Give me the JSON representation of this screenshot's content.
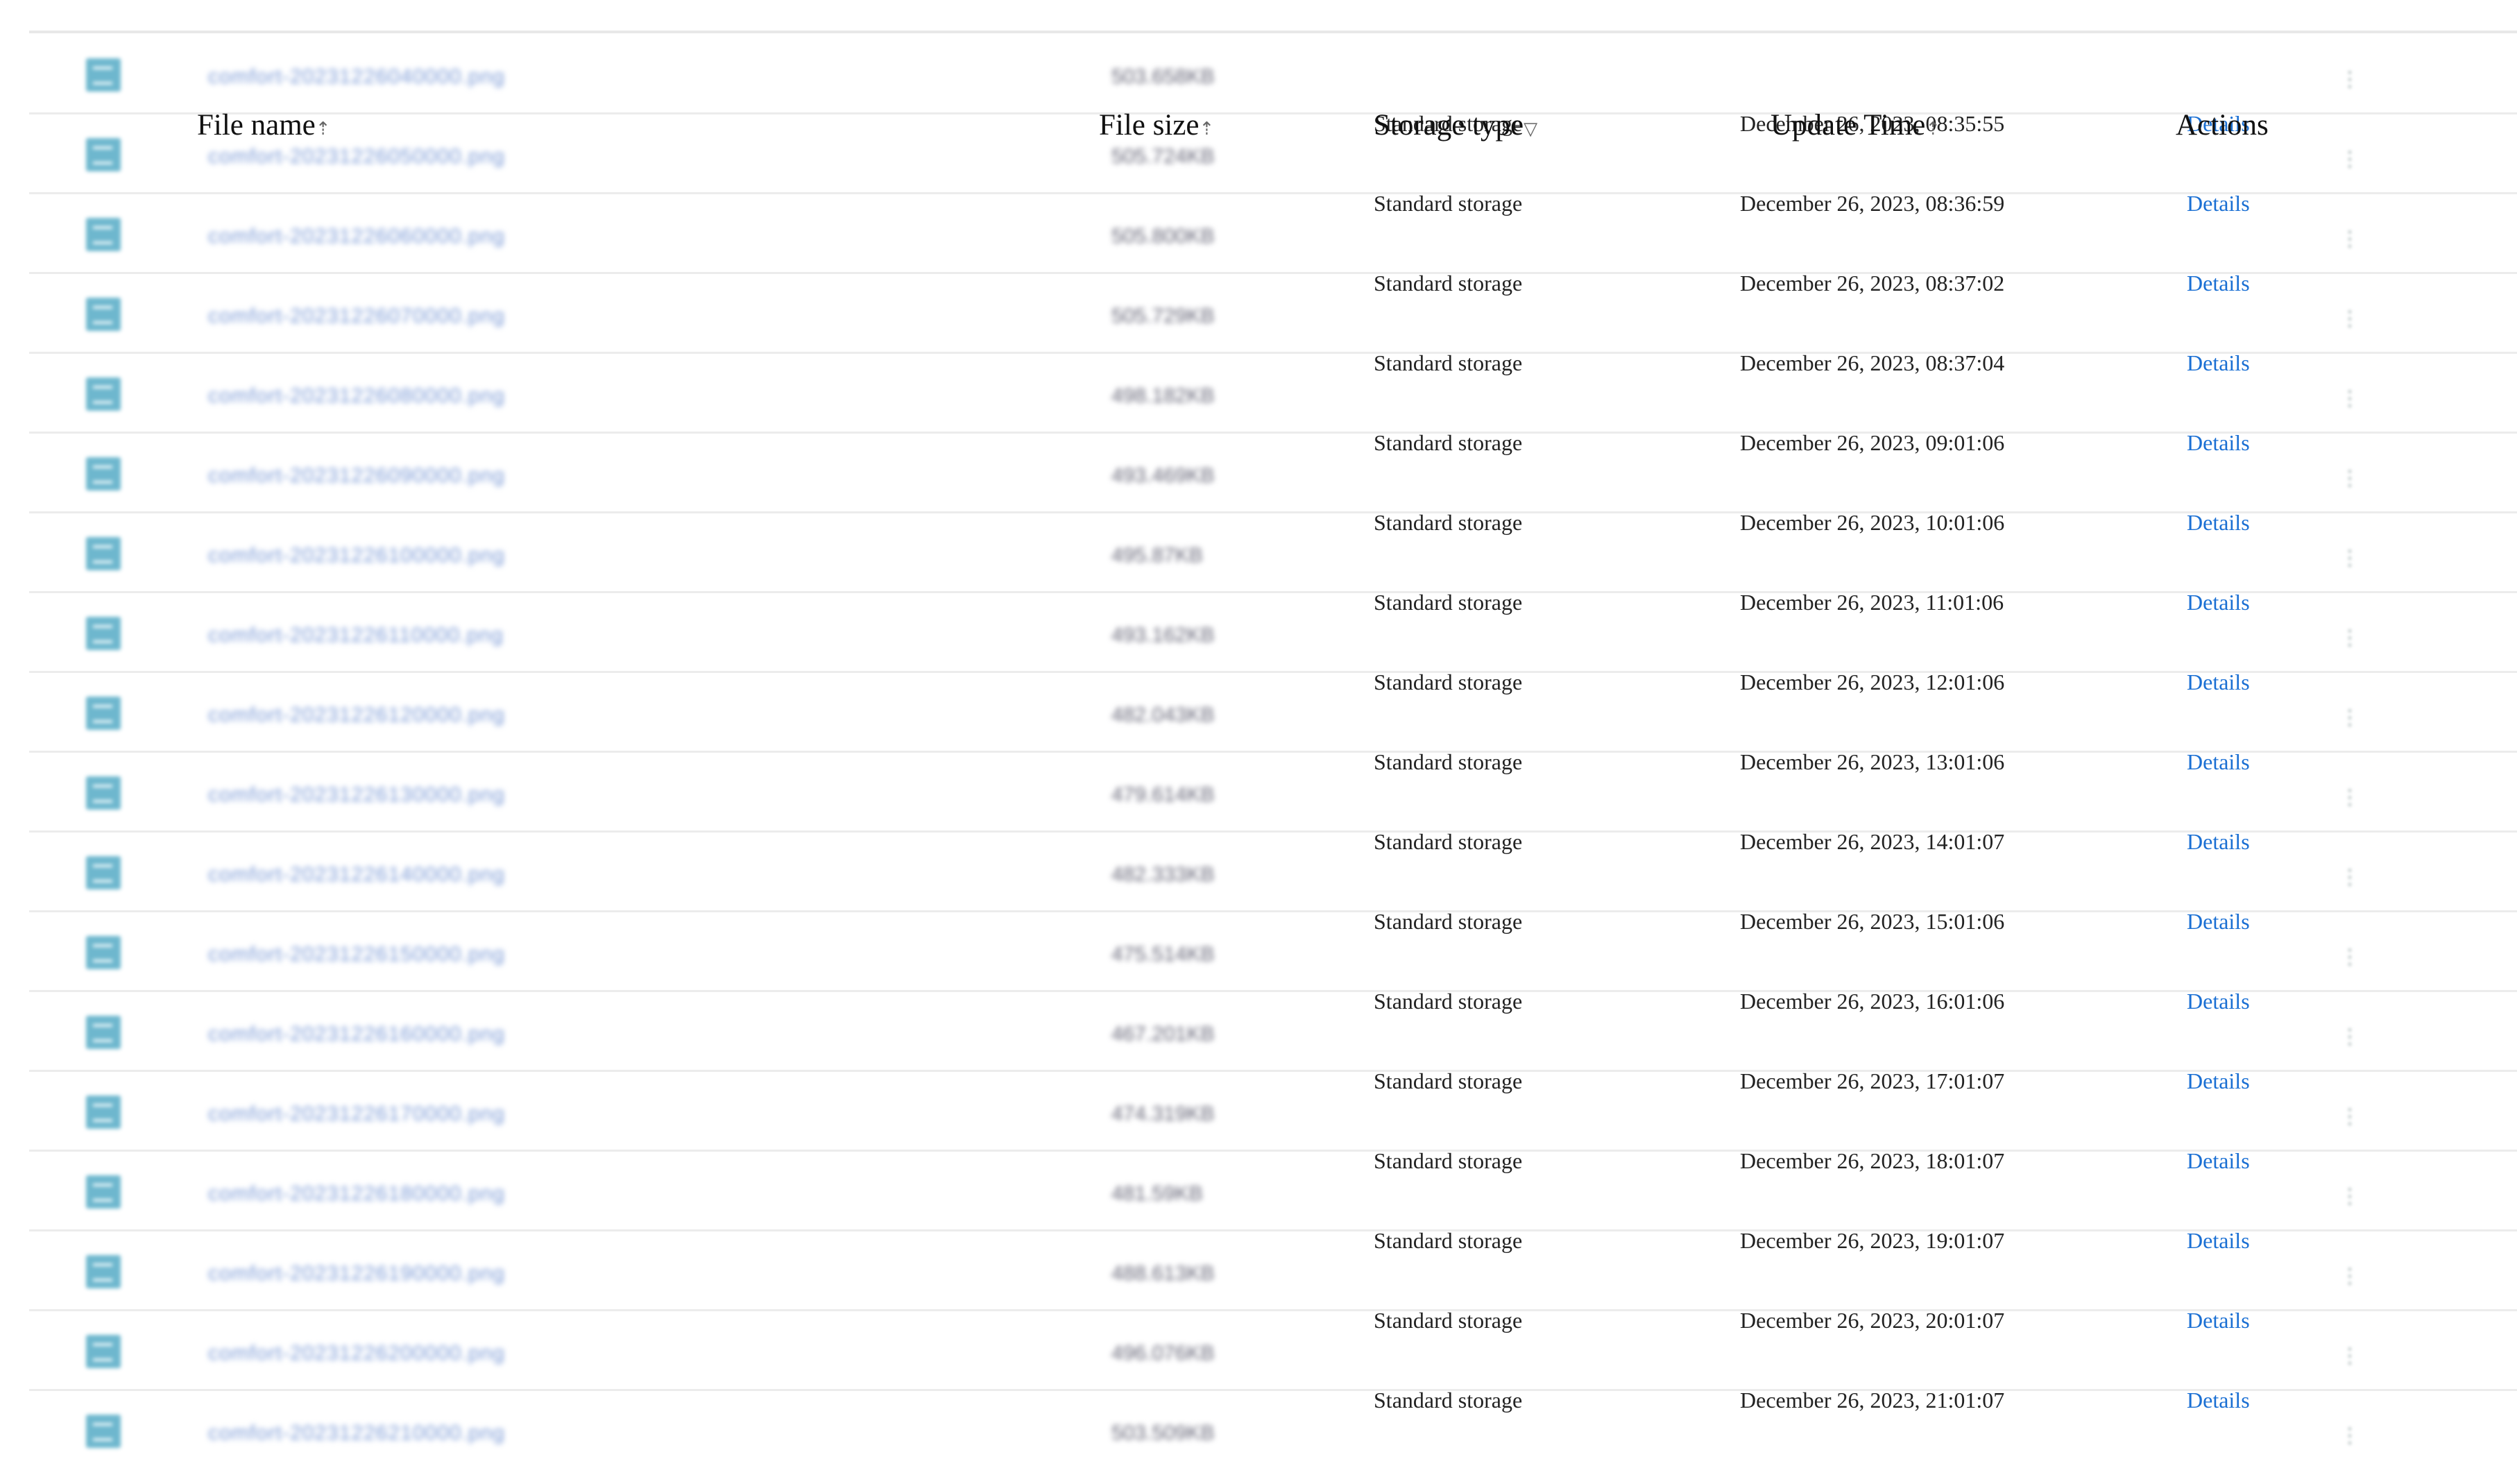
{
  "columns": {
    "file_name": "File name",
    "file_size": "File size",
    "storage_type": "Storage type",
    "update_time": "Update Time",
    "actions": "Actions"
  },
  "sort_icons": {
    "name": "⇡",
    "size": "⇡",
    "type": "▽",
    "time": "⇡"
  },
  "rows": [
    {
      "file": "comfort-20231226040000.png",
      "size": "503.658KB",
      "storage": "Standard storage",
      "time": "December 26, 2023, 08:35:55",
      "action": "Details"
    },
    {
      "file": "comfort-20231226050000.png",
      "size": "505.724KB",
      "storage": "Standard storage",
      "time": "December 26, 2023, 08:36:59",
      "action": "Details"
    },
    {
      "file": "comfort-20231226060000.png",
      "size": "505.800KB",
      "storage": "Standard storage",
      "time": "December 26, 2023, 08:37:02",
      "action": "Details"
    },
    {
      "file": "comfort-20231226070000.png",
      "size": "505.729KB",
      "storage": "Standard storage",
      "time": "December 26, 2023, 08:37:04",
      "action": "Details"
    },
    {
      "file": "comfort-20231226080000.png",
      "size": "498.182KB",
      "storage": "Standard storage",
      "time": "December 26, 2023, 09:01:06",
      "action": "Details"
    },
    {
      "file": "comfort-20231226090000.png",
      "size": "493.469KB",
      "storage": "Standard storage",
      "time": "December 26, 2023, 10:01:06",
      "action": "Details"
    },
    {
      "file": "comfort-20231226100000.png",
      "size": "495.87KB",
      "storage": "Standard storage",
      "time": "December 26, 2023, 11:01:06",
      "action": "Details"
    },
    {
      "file": "comfort-20231226110000.png",
      "size": "493.162KB",
      "storage": "Standard storage",
      "time": "December 26, 2023, 12:01:06",
      "action": "Details"
    },
    {
      "file": "comfort-20231226120000.png",
      "size": "482.043KB",
      "storage": "Standard storage",
      "time": "December 26, 2023, 13:01:06",
      "action": "Details"
    },
    {
      "file": "comfort-20231226130000.png",
      "size": "479.614KB",
      "storage": "Standard storage",
      "time": "December 26, 2023, 14:01:07",
      "action": "Details"
    },
    {
      "file": "comfort-20231226140000.png",
      "size": "482.333KB",
      "storage": "Standard storage",
      "time": "December 26, 2023, 15:01:06",
      "action": "Details"
    },
    {
      "file": "comfort-20231226150000.png",
      "size": "475.514KB",
      "storage": "Standard storage",
      "time": "December 26, 2023, 16:01:06",
      "action": "Details"
    },
    {
      "file": "comfort-20231226160000.png",
      "size": "467.201KB",
      "storage": "Standard storage",
      "time": "December 26, 2023, 17:01:07",
      "action": "Details"
    },
    {
      "file": "comfort-20231226170000.png",
      "size": "474.319KB",
      "storage": "Standard storage",
      "time": "December 26, 2023, 18:01:07",
      "action": "Details"
    },
    {
      "file": "comfort-20231226180000.png",
      "size": "481.59KB",
      "storage": "Standard storage",
      "time": "December 26, 2023, 19:01:07",
      "action": "Details"
    },
    {
      "file": "comfort-20231226190000.png",
      "size": "488.613KB",
      "storage": "Standard storage",
      "time": "December 26, 2023, 20:01:07",
      "action": "Details"
    },
    {
      "file": "comfort-20231226200000.png",
      "size": "496.076KB",
      "storage": "Standard storage",
      "time": "December 26, 2023, 21:01:07",
      "action": "Details"
    },
    {
      "file": "comfort-20231226210000.png",
      "size": "503.509KB",
      "storage": "",
      "time": "",
      "action": ""
    }
  ],
  "more_icon": "⋮"
}
